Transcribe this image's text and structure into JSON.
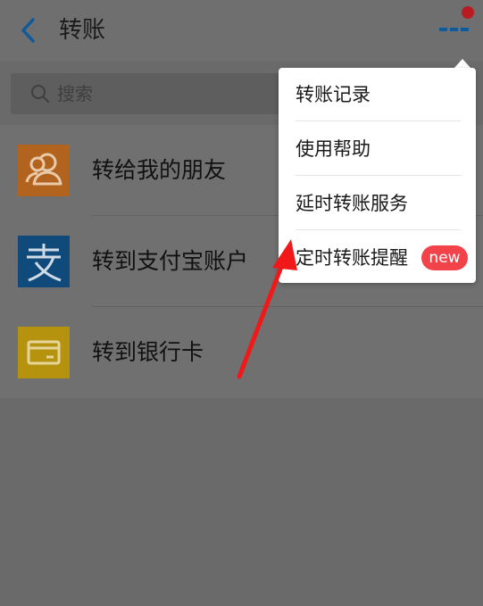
{
  "header": {
    "title": "转账",
    "back_icon": "chevron-left-icon",
    "more_icon": "more-dots-icon",
    "notification_color": "#b81c22",
    "accent": "#0e5a9a"
  },
  "search": {
    "placeholder": "搜索",
    "icon": "search-icon"
  },
  "transfer_options": [
    {
      "label": "转给我的朋友",
      "icon": "friends-icon",
      "color": "#b2641f"
    },
    {
      "label": "转到支付宝账户",
      "icon": "alipay-icon",
      "color": "#0f4a7a"
    },
    {
      "label": "转到银行卡",
      "icon": "bank-card-icon",
      "color": "#b5930f"
    }
  ],
  "menu": {
    "items": [
      {
        "label": "转账记录"
      },
      {
        "label": "使用帮助"
      },
      {
        "label": "延时转账服务"
      },
      {
        "label": "定时转账提醒",
        "badge": "new"
      }
    ],
    "badge_color": "#f2434a"
  },
  "annotation": {
    "arrow_color": "#f01818"
  }
}
